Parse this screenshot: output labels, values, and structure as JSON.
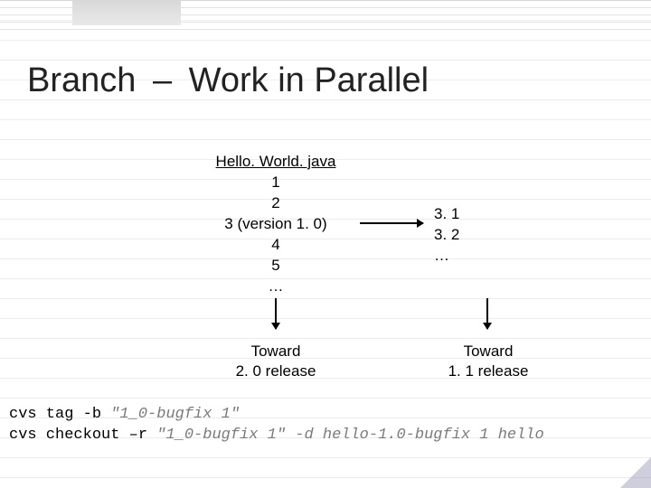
{
  "title": {
    "a": "Branch",
    "dash": "–",
    "b": "Work in Parallel"
  },
  "file": {
    "name": "Hello. World. java",
    "revs": [
      "1",
      "2",
      "3 (version 1. 0)",
      "4",
      "5",
      "…"
    ]
  },
  "branch": {
    "revs": [
      "3. 1",
      "3. 2",
      "…"
    ]
  },
  "captions": {
    "left_l1": "Toward",
    "left_l2": "2. 0 release",
    "right_l1": "Toward",
    "right_l2": "1. 1 release"
  },
  "cmd1": {
    "kw": "cvs tag -b",
    "arg": " \"1_0-bugfix 1\""
  },
  "cmd2": {
    "kw": "cvs checkout –r",
    "arg": " \"1_0-bugfix 1\" -d hello-1.0-bugfix 1 hello"
  }
}
